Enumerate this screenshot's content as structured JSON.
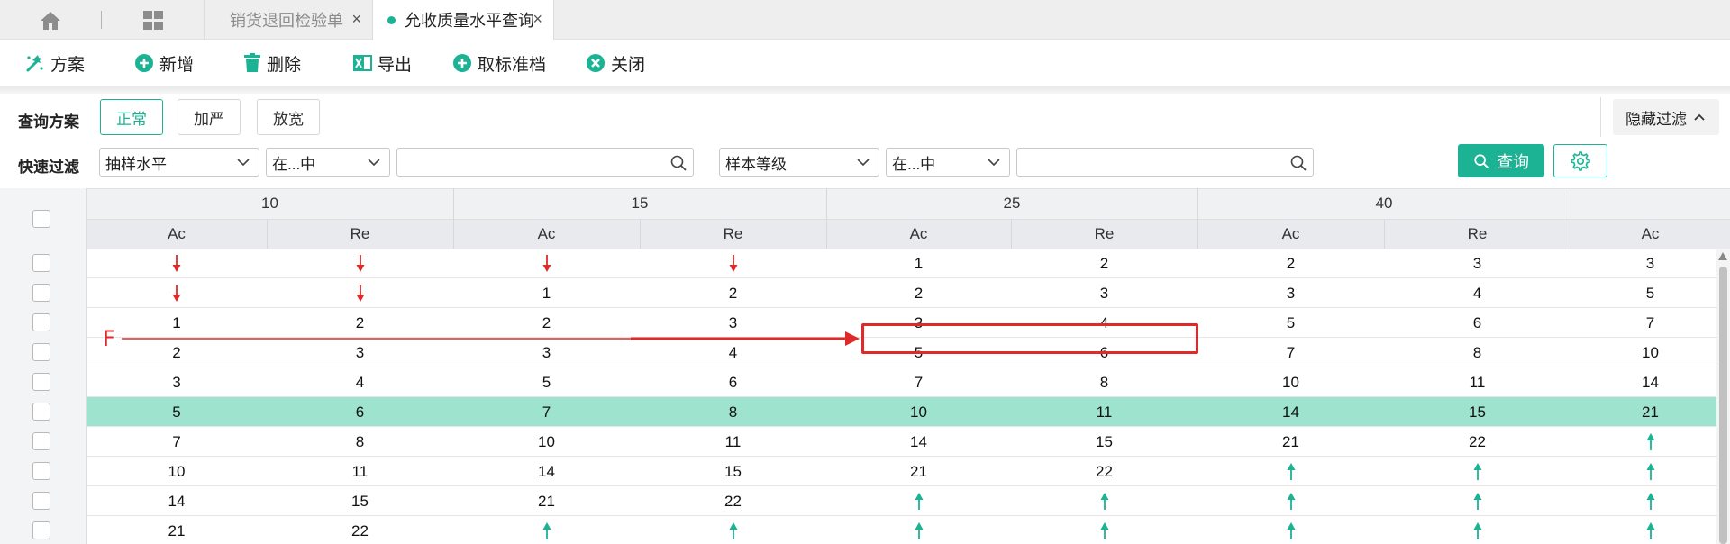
{
  "tabs": {
    "tab1": "销货退回检验单",
    "tab2": "允收质量水平查询",
    "close": "×"
  },
  "toolbar": {
    "scheme": "方案",
    "add": "新增",
    "delete": "删除",
    "export": "导出",
    "cancel_standard": "取标准档",
    "close": "关闭"
  },
  "filter": {
    "scheme_label": "查询方案",
    "schemes": [
      "正常",
      "加严",
      "放宽"
    ],
    "hide_filter": "隐藏过滤",
    "quick_label": "快速过滤",
    "field1": "抽样水平",
    "op1": "在...中",
    "value1": "",
    "field2": "样本等级",
    "op2": "在...中",
    "value2": "",
    "query": "查询"
  },
  "grid": {
    "groups": [
      "10",
      "15",
      "25",
      "40"
    ],
    "subheaders": [
      "Ac",
      "Re",
      "Ac",
      "Re",
      "Ac",
      "Re",
      "Ac",
      "Re",
      "Ac"
    ],
    "rows": [
      [
        "↓",
        "↓",
        "↓",
        "↓",
        "1",
        "2",
        "2",
        "3",
        "3"
      ],
      [
        "↓",
        "↓",
        "1",
        "2",
        "2",
        "3",
        "3",
        "4",
        "5"
      ],
      [
        "1",
        "2",
        "2",
        "3",
        "3",
        "4",
        "5",
        "6",
        "7"
      ],
      [
        "2",
        "3",
        "3",
        "4",
        "5",
        "6",
        "7",
        "8",
        "10"
      ],
      [
        "3",
        "4",
        "5",
        "6",
        "7",
        "8",
        "10",
        "11",
        "14"
      ],
      [
        "5",
        "6",
        "7",
        "8",
        "10",
        "11",
        "14",
        "15",
        "21"
      ],
      [
        "7",
        "8",
        "10",
        "11",
        "14",
        "15",
        "21",
        "22",
        "↑"
      ],
      [
        "10",
        "11",
        "14",
        "15",
        "21",
        "22",
        "↑",
        "↑",
        "↑"
      ],
      [
        "14",
        "15",
        "21",
        "22",
        "↑",
        "↑",
        "↑",
        "↑",
        "↑"
      ],
      [
        "21",
        "22",
        "↑",
        "↑",
        "↑",
        "↑",
        "↑",
        "↑",
        "↑"
      ]
    ],
    "highlighted_row_index": 5
  },
  "annotation": {
    "marker": "F"
  },
  "colors": {
    "accent": "#1bb394",
    "highlight_row": "#9de3ce",
    "arrow_down": "#e02a2a",
    "arrow_up": "#1bb394",
    "annotation": "#e02a2a"
  }
}
